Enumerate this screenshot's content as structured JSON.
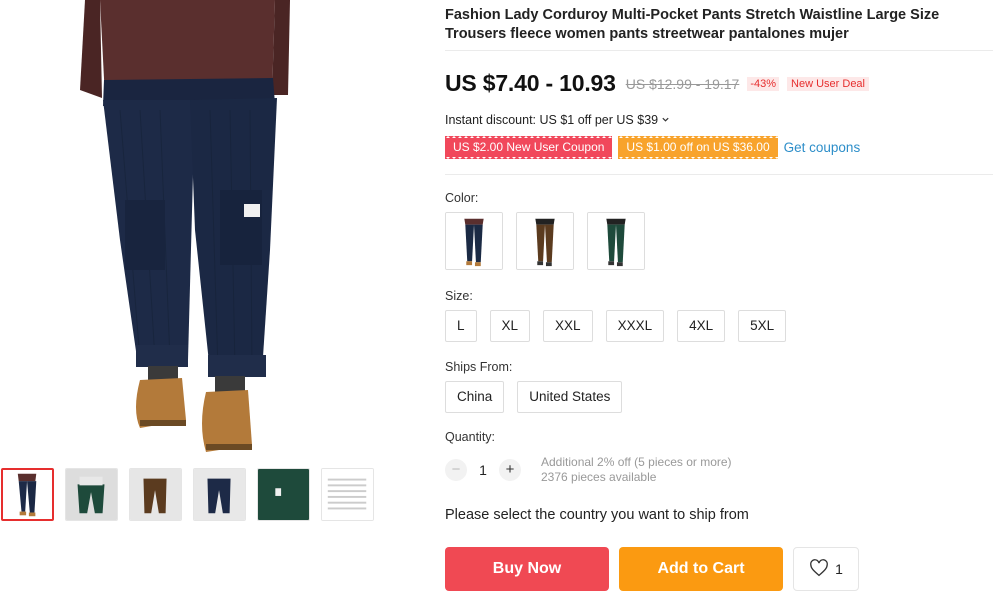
{
  "product": {
    "title": "Fashion Lady Corduroy Multi-Pocket Pants Stretch Waistline Large Size Trousers fleece women pants streetwear pantalones mujer",
    "price": "US $7.40 - 10.93",
    "old_price": "US $12.99 - 19.17",
    "discount": "-43%",
    "deal_badge": "New User Deal"
  },
  "instant_discount": "Instant discount: US $1 off per US $39",
  "coupons": [
    {
      "label": "US $2.00 New User Coupon",
      "color": "#f1485b"
    },
    {
      "label": "US $1.00 off on US $36.00",
      "color": "#f8a32c"
    }
  ],
  "get_coupons": "Get coupons",
  "color": {
    "label": "Color:",
    "options": [
      {
        "name": "navy",
        "hex": "#1b2a44"
      },
      {
        "name": "brown",
        "hex": "#5b3b1f"
      },
      {
        "name": "green",
        "hex": "#1e4a3b"
      }
    ]
  },
  "size": {
    "label": "Size:",
    "options": [
      "L",
      "XL",
      "XXL",
      "XXXL",
      "4XL",
      "5XL"
    ]
  },
  "ships_from": {
    "label": "Ships From:",
    "options": [
      "China",
      "United States"
    ]
  },
  "quantity": {
    "label": "Quantity:",
    "value": "1",
    "minus": "−",
    "plus": "+",
    "note": "Additional 2% off (5 pieces or more)",
    "available": "2376 pieces available"
  },
  "ship_message": "Please select the country you want to ship from",
  "buttons": {
    "buy": "Buy Now",
    "cart": "Add to Cart",
    "wishlist_count": "1"
  },
  "icons": {
    "chevron": "chevron-down-icon",
    "wishlist": "heart-icon"
  },
  "colors": {
    "buy": "#f04953",
    "cart": "#fb9a11",
    "link": "#2d8ec9",
    "active_thumb": "#e62e2e"
  }
}
